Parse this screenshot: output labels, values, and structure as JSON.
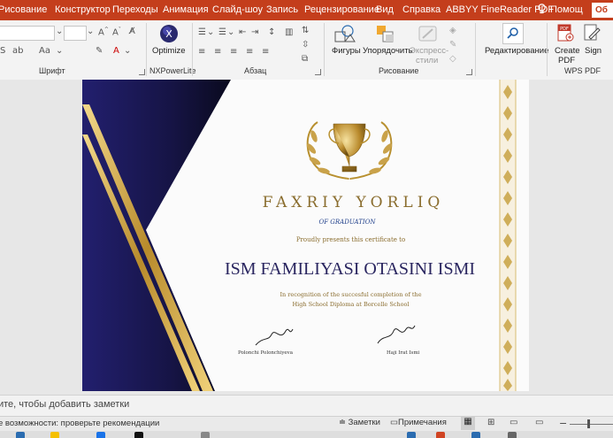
{
  "ribbon_tabs": [
    {
      "label": "Рисование"
    },
    {
      "label": "Конструктор"
    },
    {
      "label": "Переходы"
    },
    {
      "label": "Анимация"
    },
    {
      "label": "Слайд-шоу"
    },
    {
      "label": "Запись"
    },
    {
      "label": "Рецензирование"
    },
    {
      "label": "Вид"
    },
    {
      "label": "Справка"
    },
    {
      "label": "ABBYY FineReader PDF"
    }
  ],
  "help_label": "Помощ",
  "share_label": "Об",
  "ribbon": {
    "font_group": "Шрифт",
    "nxpowerlite_group": "NXPowerLite",
    "optimize_label": "Optimize",
    "paragraph_group": "Абзац",
    "drawing_group": "Рисование",
    "shapes_label": "Фигуры",
    "arrange_label": "Упорядочить",
    "quick_styles_label_1": "Экспресс-",
    "quick_styles_label_2": "стили",
    "editing_label": "Редактирование",
    "create_pdf_label_1": "Create",
    "create_pdf_label_2": "PDF",
    "sign_label": "Sign",
    "wps_group": "WPS PDF"
  },
  "slide": {
    "title": "FAXRIY YORLIQ",
    "subtitle": "OF GRADUATION",
    "presents": "Proudly presents this certificate to",
    "name": "ISM FAMILIYASI OTASINI ISMI",
    "recognition_1": "In recognition of the succesful completion of the",
    "recognition_2": "High School Diploma at Borcelle School",
    "signer_left": "Polonchi Polonchiyeva",
    "signer_right": "Haji Irat Ismi"
  },
  "notes_placeholder": "ите, чтобы добавить заметки",
  "status": {
    "accessibility": "е возможности: проверьте рекомендации",
    "notes_button": "Заметки",
    "comments_button": "Примечания"
  },
  "colors": {
    "ribbon_accent": "#c43e1c",
    "navy": "#1c1a5c",
    "gold": "#c9a24a",
    "name_color": "#2a2660"
  }
}
